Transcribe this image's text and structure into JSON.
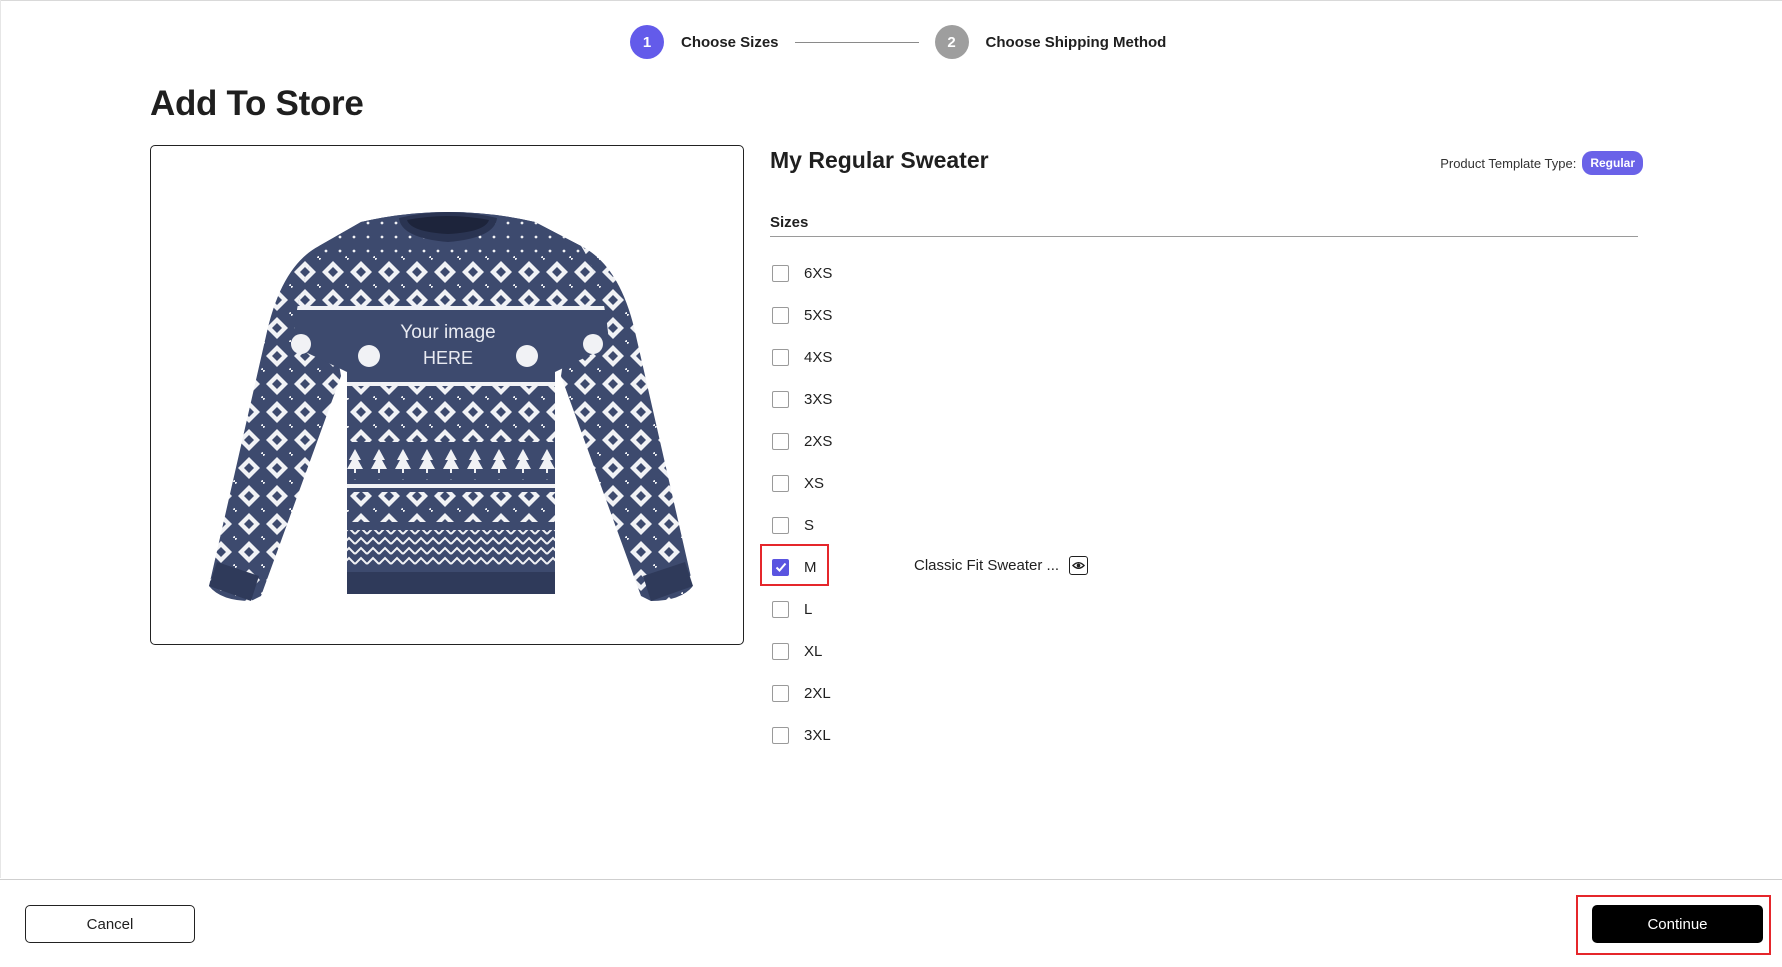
{
  "stepper": {
    "steps": [
      {
        "number": "1",
        "label": "Choose Sizes",
        "color": "#635bea"
      },
      {
        "number": "2",
        "label": "Choose Shipping Method",
        "color": "#9e9e9e"
      }
    ]
  },
  "page": {
    "title": "Add To Store"
  },
  "product": {
    "image_text_line1": "Your image",
    "image_text_line2": "HERE",
    "name": "My Regular Sweater",
    "template_type_label": "Product Template Type:",
    "template_type_value": "Regular"
  },
  "sizes": {
    "heading": "Sizes",
    "items": [
      {
        "label": "6XS",
        "checked": false
      },
      {
        "label": "5XS",
        "checked": false
      },
      {
        "label": "4XS",
        "checked": false
      },
      {
        "label": "3XS",
        "checked": false
      },
      {
        "label": "2XS",
        "checked": false
      },
      {
        "label": "XS",
        "checked": false
      },
      {
        "label": "S",
        "checked": false
      },
      {
        "label": "M",
        "checked": true
      },
      {
        "label": "L",
        "checked": false
      },
      {
        "label": "XL",
        "checked": false
      },
      {
        "label": "2XL",
        "checked": false
      },
      {
        "label": "3XL",
        "checked": false
      }
    ],
    "selected_variant": "Classic Fit Sweater ..."
  },
  "footer": {
    "cancel_label": "Cancel",
    "continue_label": "Continue"
  },
  "colors": {
    "accent": "#635bea",
    "sweater_navy": "#3d4a6e",
    "highlight_red": "#e5262b"
  }
}
